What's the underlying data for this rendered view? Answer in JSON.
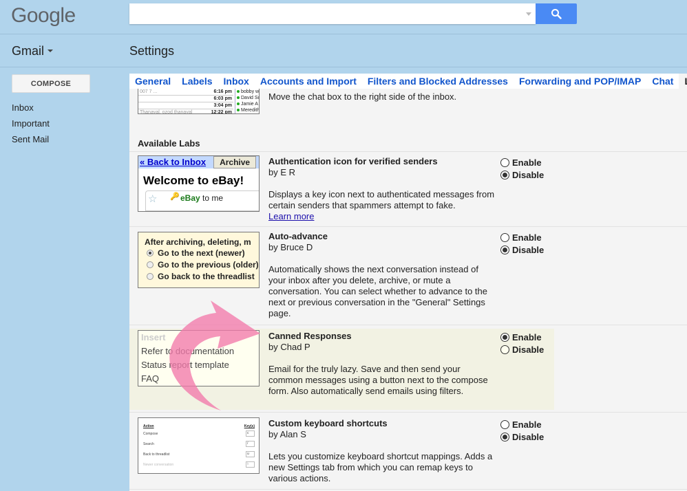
{
  "header": {
    "logo": "Google",
    "search": {
      "value": "",
      "placeholder": ""
    },
    "app_switcher": "Gmail",
    "page_title": "Settings"
  },
  "sidebar": {
    "compose_label": "COMPOSE",
    "items": [
      {
        "label": "Inbox"
      },
      {
        "label": "Important"
      },
      {
        "label": "Sent Mail"
      }
    ]
  },
  "tabs": [
    {
      "label": "General",
      "active": false
    },
    {
      "label": "Labels",
      "active": false
    },
    {
      "label": "Inbox",
      "active": false
    },
    {
      "label": "Accounts and Import",
      "active": false
    },
    {
      "label": "Filters and Blocked Addresses",
      "active": false
    },
    {
      "label": "Forwarding and POP/IMAP",
      "active": false
    },
    {
      "label": "Chat",
      "active": false
    },
    {
      "label": "Labs",
      "active": true
    }
  ],
  "chat_lab": {
    "description": "Move the chat box to the right side of the inbox.",
    "thumb_rows": [
      {
        "sender": "007 7 ...",
        "time": "6:16 pm"
      },
      {
        "sender": "",
        "time": "6:03 pm"
      },
      {
        "sender": "",
        "time": "3:04 pm"
      },
      {
        "sender": "Thanayal, ozod thanayal",
        "time": "12:22 pm"
      }
    ],
    "thumb_contacts": [
      "bobby w",
      "David So",
      "Jamie A",
      "Meredith"
    ]
  },
  "available_heading": "Available Labs",
  "option_labels": {
    "enable": "Enable",
    "disable": "Disable"
  },
  "labs": [
    {
      "name": "Authentication icon for verified senders",
      "author": "by E R",
      "description": "Displays a key icon next to authenticated messages from certain senders that spammers attempt to fake.",
      "link": "Learn more",
      "selected": "disable",
      "thumb": {
        "back": "« Back to Inbox",
        "archive": "Archive",
        "title": "Welcome to eBay!",
        "sender": "eBay",
        "to": "to me"
      }
    },
    {
      "name": "Auto-advance",
      "author": "by Bruce D",
      "description": "Automatically shows the next conversation instead of your inbox after you delete, archive, or mute a conversation. You can select whether to advance to the next or previous conversation in the \"General\" Settings page.",
      "selected": "disable",
      "thumb": {
        "title": "After archiving, deleting, m",
        "options": [
          {
            "label": "Go to the next (newer)",
            "on": true
          },
          {
            "label": "Go to the previous (older)",
            "on": false
          },
          {
            "label": "Go back to the threadlist",
            "on": false
          }
        ]
      }
    },
    {
      "name": "Canned Responses",
      "author": "by Chad P",
      "description": "Email for the truly lazy. Save and then send your common messages using a button next to the compose form. Also automatically send emails using filters.",
      "selected": "enable",
      "highlighted": true,
      "thumb": {
        "items": [
          "Insert",
          "Refer to documentation",
          "Status report template",
          "FAQ"
        ]
      }
    },
    {
      "name": "Custom keyboard shortcuts",
      "author": "by Alan S",
      "description": "Lets you customize keyboard shortcut mappings. Adds a new Settings tab from which you can remap keys to various actions.",
      "selected": "disable",
      "thumb": {
        "col_action": "Action",
        "col_keys": "Key(s)",
        "rows": [
          {
            "action": "Compose",
            "key": "c"
          },
          {
            "action": "Search",
            "key": "/"
          },
          {
            "action": "Back to threadlist",
            "key": "u"
          },
          {
            "action": "Newer conversation",
            "key": "k"
          }
        ]
      }
    }
  ],
  "colors": {
    "header_bg": "#b1d4ec",
    "search_button": "#4a8af4",
    "tab_link": "#1155cc",
    "highlight_row": "#f2f2e3",
    "annotation_arrow": "#f27aab"
  }
}
